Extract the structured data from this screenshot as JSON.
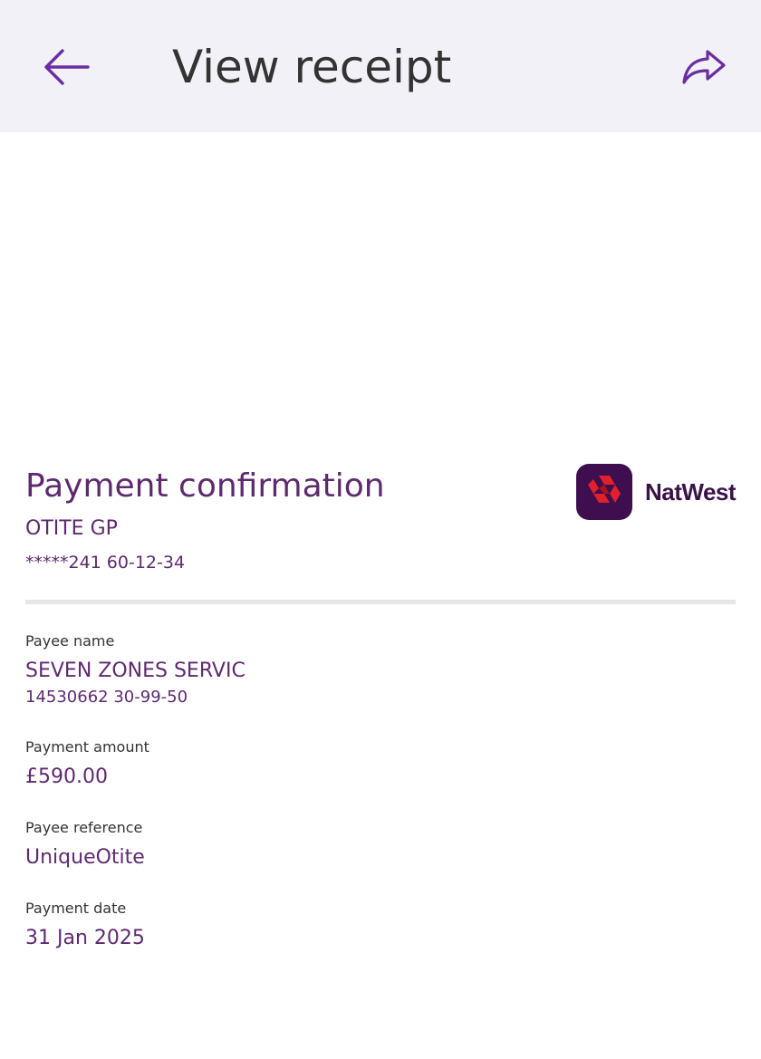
{
  "app_bar": {
    "title": "View receipt",
    "back_icon": "arrow-left-icon",
    "share_icon": "share-icon"
  },
  "receipt": {
    "heading": "Payment confirmation",
    "brand_name": "NatWest",
    "account_name": "OTITE GP",
    "account_number": "*****241 60-12-34"
  },
  "fields": {
    "payee_name": {
      "label": "Payee name",
      "value": "SEVEN ZONES SERVIC",
      "account": "14530662 30-99-50"
    },
    "payment_amount": {
      "label": "Payment amount",
      "value": "£590.00"
    },
    "payee_reference": {
      "label": "Payee reference",
      "value": "UniqueOtite"
    },
    "payment_date": {
      "label": "Payment date",
      "value": "31 Jan 2025"
    }
  },
  "colors": {
    "accent": "#5e2a6f",
    "icon": "#6a2ea0",
    "app_bar_bg": "#f2f1f7",
    "brand_mark_bg": "#3e0e4f",
    "brand_red": "#e0202a",
    "divider": "#e6e6e6"
  }
}
